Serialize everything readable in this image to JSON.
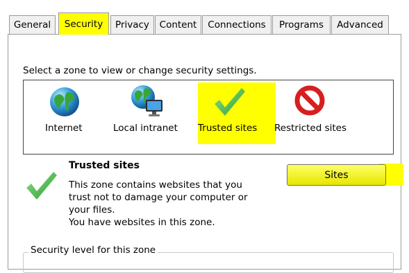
{
  "tabs": [
    {
      "label": "General"
    },
    {
      "label": "Security"
    },
    {
      "label": "Privacy"
    },
    {
      "label": "Content"
    },
    {
      "label": "Connections"
    },
    {
      "label": "Programs"
    },
    {
      "label": "Advanced"
    }
  ],
  "active_tab": "Security",
  "instruction": "Select a zone to view or change security settings.",
  "zones": [
    {
      "label": "Internet",
      "icon": "globe-icon"
    },
    {
      "label": "Local intranet",
      "icon": "intranet-icon"
    },
    {
      "label": "Trusted sites",
      "icon": "checkmark-icon"
    },
    {
      "label": "Restricted sites",
      "icon": "prohibited-icon"
    }
  ],
  "selected_zone": {
    "title": "Trusted sites",
    "description_lines": [
      "This zone contains websites that you",
      "trust not to damage your computer or",
      "your files.",
      "You have websites in this zone."
    ]
  },
  "sites_button": "Sites",
  "security_level_label": "Security level for this zone",
  "colors": {
    "highlight": "#ffff00",
    "check_green": "#3cb93c",
    "prohibit_red": "#d81e1e"
  }
}
